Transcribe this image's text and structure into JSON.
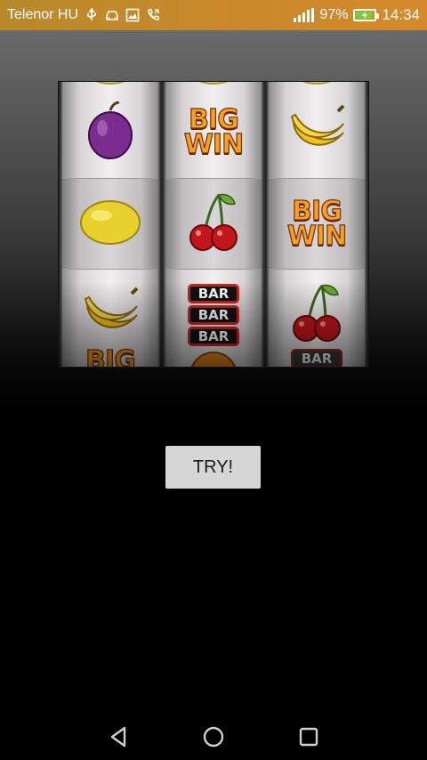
{
  "status_bar": {
    "carrier": "Telenor HU",
    "battery_percent": "97%",
    "battery_level": 0.97,
    "time": "14:34",
    "icons": [
      "usb-icon",
      "car-icon",
      "image-icon",
      "call-icon",
      "signal-icon",
      "battery-icon"
    ]
  },
  "slot_machine": {
    "reels": [
      {
        "top_peek": "lemon",
        "visible": [
          "plum",
          "lemon",
          "banana"
        ],
        "bottom_peek": "big-win"
      },
      {
        "top_peek": "lemon",
        "visible": [
          "big-win",
          "cherry",
          "bar-triple"
        ],
        "bottom_peek": "orange"
      },
      {
        "top_peek": "lemon",
        "visible": [
          "banana",
          "big-win",
          "cherry"
        ],
        "bottom_peek": "bar"
      }
    ],
    "big_win_line1": "BIG",
    "big_win_line2": "WIN",
    "bar_label": "BAR",
    "colors": {
      "plum": "#7a2c8f",
      "lemon": "#e8d12c",
      "banana": "#f2c21d",
      "cherry": "#c3161c",
      "big_win": "#f6a21a",
      "bar_border": "#c6261e"
    }
  },
  "actions": {
    "try_label": "TRY!"
  },
  "nav_bar": {
    "icons": [
      "back-icon",
      "home-icon",
      "recent-apps-icon"
    ]
  }
}
